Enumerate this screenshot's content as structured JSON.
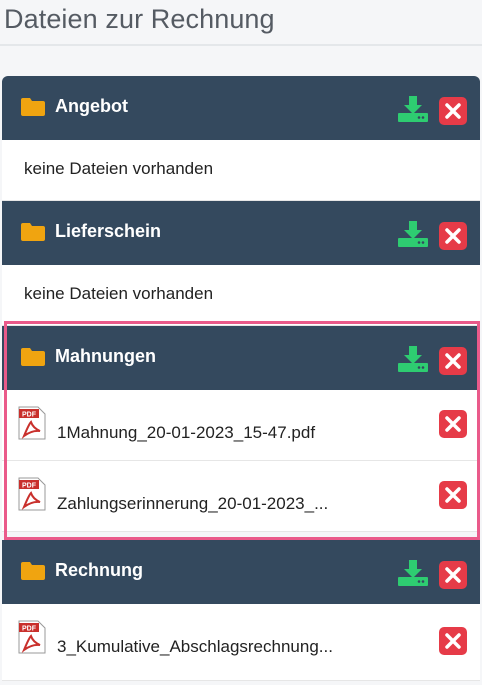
{
  "page": {
    "title": "Dateien zur Rechnung"
  },
  "colors": {
    "header_bg": "#34495e",
    "folder": "#f0a410",
    "download": "#2ecc71",
    "delete": "#e63b48",
    "highlight": "#ea5a8a"
  },
  "icons": {
    "folder": "folder-icon",
    "download": "download-icon",
    "delete": "close-icon",
    "pdf": "pdf-file-icon"
  },
  "sections": [
    {
      "title": "Angebot",
      "empty_text": "keine Dateien vorhanden",
      "files": []
    },
    {
      "title": "Lieferschein",
      "empty_text": "keine Dateien vorhanden",
      "files": []
    },
    {
      "title": "Mahnungen",
      "highlighted": true,
      "files": [
        {
          "name": "1Mahnung_20-01-2023_15-47.pdf"
        },
        {
          "name": "Zahlungserinnerung_20-01-2023_..."
        }
      ]
    },
    {
      "title": "Rechnung",
      "files": [
        {
          "name": "3_Kumulative_Abschlagsrechnung..."
        }
      ]
    }
  ]
}
